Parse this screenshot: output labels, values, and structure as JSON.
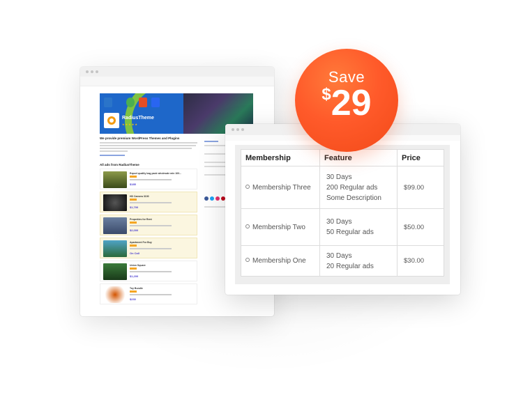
{
  "badge": {
    "label": "Save",
    "currency": "$",
    "amount": "29",
    "color": "#f24a18"
  },
  "back_window": {
    "brand": "RadiusTheme",
    "intro_title": "We provide premium WordPress Themes and Plugins",
    "section_title": "All ads from RadiusTheme",
    "ads": [
      {
        "title": "Export quality bag pack wholesale min 100...",
        "price": "$185"
      },
      {
        "title": "HD Camera 3100",
        "price": "$1,700"
      },
      {
        "title": "Properties for Rent",
        "price": "$2,000"
      },
      {
        "title": "Apartment For Buy",
        "price": "On Call"
      },
      {
        "title": "Union Square",
        "price": "$1,200"
      },
      {
        "title": "Toy Bundle",
        "price": "$230"
      }
    ]
  },
  "membership_table": {
    "headers": {
      "membership": "Membership",
      "feature": "Feature",
      "price": "Price"
    },
    "rows": [
      {
        "name": "Membership Three",
        "features": [
          "30 Days",
          "200 Regular ads",
          "Some Description"
        ],
        "price": "$99.00"
      },
      {
        "name": "Membership Two",
        "features": [
          "30 Days",
          "50 Regular ads"
        ],
        "price": "$50.00"
      },
      {
        "name": "Membership One",
        "features": [
          "30 Days",
          "20 Regular ads"
        ],
        "price": "$30.00"
      }
    ]
  }
}
